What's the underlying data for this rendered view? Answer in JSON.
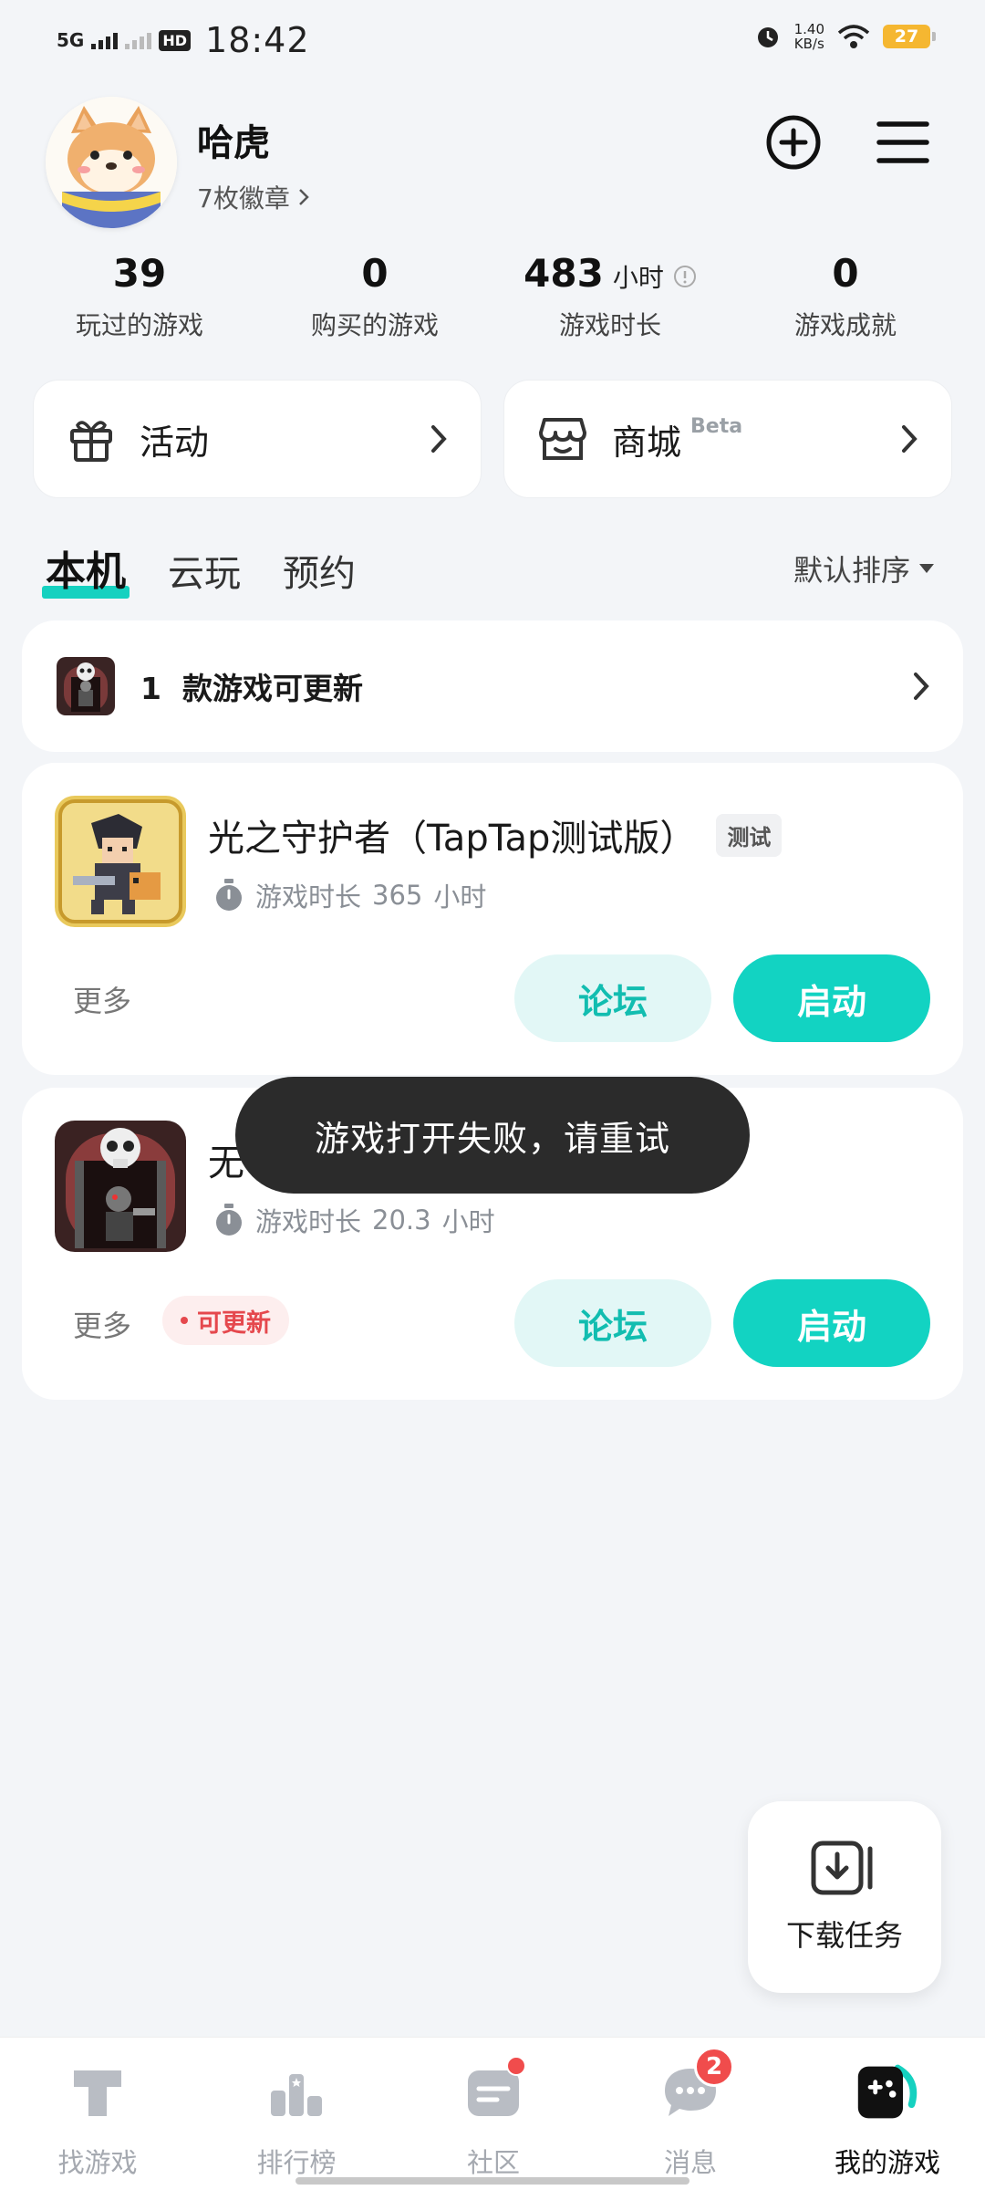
{
  "status_bar": {
    "network": "5G",
    "hd": "HD",
    "time": "18:42",
    "speed_value": "1.40",
    "speed_unit": "KB/s",
    "battery": "27"
  },
  "profile": {
    "username": "哈虎",
    "badges": "7枚徽章"
  },
  "stats": [
    {
      "value": "39",
      "unit": "",
      "label": "玩过的游戏"
    },
    {
      "value": "0",
      "unit": "",
      "label": "购买的游戏"
    },
    {
      "value": "483",
      "unit": "小时",
      "label": "游戏时长"
    },
    {
      "value": "0",
      "unit": "",
      "label": "游戏成就"
    }
  ],
  "quick_links": {
    "events": "活动",
    "store": "商城",
    "store_tag": "Beta"
  },
  "tabs": [
    "本机",
    "云玩",
    "预约"
  ],
  "sort_label": "默认排序",
  "update_banner": {
    "count": "1",
    "text": "款游戏可更新"
  },
  "games": [
    {
      "title": "光之守护者（TapTap测试版）",
      "tag": "测试",
      "playtime_label": "游戏时长",
      "playtime_value": "365",
      "playtime_unit": "小时",
      "more": "更多",
      "forum": "论坛",
      "launch": "启动"
    },
    {
      "title": "无",
      "playtime_label": "游戏时长",
      "playtime_value": "20.3",
      "playtime_unit": "小时",
      "more": "更多",
      "update_tag": "可更新",
      "forum": "论坛",
      "launch": "启动"
    }
  ],
  "toast": "游戏打开失败，请重试",
  "download_task": "下载任务",
  "bottom_nav": [
    {
      "label": "找游戏",
      "icon": "find-games-icon"
    },
    {
      "label": "排行榜",
      "icon": "ranking-icon"
    },
    {
      "label": "社区",
      "icon": "community-icon"
    },
    {
      "label": "消息",
      "icon": "message-icon",
      "badge": "2"
    },
    {
      "label": "我的游戏",
      "icon": "my-games-icon",
      "active": true
    }
  ],
  "colors": {
    "accent": "#12d3c2",
    "accent_soft": "#e2f7f6",
    "badge_red": "#f04c4c",
    "battery": "#f5b731"
  }
}
